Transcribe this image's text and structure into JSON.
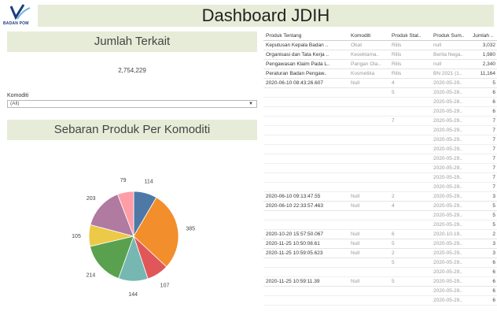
{
  "logo": {
    "text": "BADAN POM"
  },
  "header": {
    "title": "Dashboard JDIH"
  },
  "jumlah_terkait": {
    "title": "Jumlah Terkait",
    "value": "2,754,229"
  },
  "filter": {
    "label": "Komoditi",
    "selected": "(All)"
  },
  "sebaran": {
    "title": "Sebaran Produk Per Komoditi"
  },
  "table": {
    "columns": [
      "Produk Tentang",
      "Komoditi",
      "Produk Stat..",
      "Produk Sum..",
      "Jumlah .."
    ],
    "rows": [
      [
        "Keputusan Kepala Badan ..",
        "Obat",
        "Rilis",
        "null",
        "3,032"
      ],
      [
        "Organisasi dan Tata Kerja ..",
        "Kesektama..",
        "Rilis",
        "Berita Nega..",
        "1,980"
      ],
      [
        "Pengawasan Klaim Pada L..",
        "Pangan Ola..",
        "Rilis",
        "null",
        "2,340"
      ],
      [
        "Peraturan Badan Pengaw..",
        "Kosmetika",
        "Rilis",
        "BN 2021 (1..",
        "11,164"
      ],
      [
        "2020-06-10 08:43:26.607",
        "Null",
        "4",
        "2020-05-29..",
        "5"
      ],
      [
        "",
        "",
        "5",
        "2020-05-28..",
        "6"
      ],
      [
        "",
        "",
        "",
        "2020-05-28..",
        "6"
      ],
      [
        "",
        "",
        "",
        "2020-05-29..",
        "6"
      ],
      [
        "",
        "",
        "7",
        "2020-05-29..",
        "7"
      ],
      [
        "",
        "",
        "",
        "2020-05-29..",
        "7"
      ],
      [
        "",
        "",
        "",
        "2020-05-29..",
        "7"
      ],
      [
        "",
        "",
        "",
        "2020-05-29..",
        "7"
      ],
      [
        "",
        "",
        "",
        "2020-05-29..",
        "7"
      ],
      [
        "",
        "",
        "",
        "2020-05-29..",
        "7"
      ],
      [
        "",
        "",
        "",
        "2020-05-29..",
        "7"
      ],
      [
        "",
        "",
        "",
        "2020-05-29..",
        "7"
      ],
      [
        "2020-06-10 09:13:47.55",
        "Null",
        "2",
        "2020-05-29..",
        "3"
      ],
      [
        "2020-06-10 22:33:57.463",
        "Null",
        "4",
        "2020-05-29..",
        "5"
      ],
      [
        "",
        "",
        "",
        "2020-05-29..",
        "5"
      ],
      [
        "",
        "",
        "",
        "2020-05-29..",
        "5"
      ],
      [
        "2020-10-20 15:57:50.067",
        "Null",
        "6",
        "2020-10-19..",
        "2"
      ],
      [
        "2020-11-25 10:50:08.61",
        "Null",
        "5",
        "2020-05-29..",
        "3"
      ],
      [
        "2020-11-25 10:59:05.623",
        "Null",
        "2",
        "2020-05-29..",
        "3"
      ],
      [
        "",
        "",
        "5",
        "2020-05-29..",
        "6"
      ],
      [
        "",
        "",
        "",
        "2020-05-29..",
        "6"
      ],
      [
        "2020-11-25 10:59:11.39",
        "Null",
        "5",
        "2020-05-29..",
        "6"
      ],
      [
        "",
        "",
        "",
        "2020-05-29..",
        "6"
      ],
      [
        "",
        "",
        "",
        "2020-05-29..",
        "6"
      ]
    ]
  },
  "chart_data": {
    "type": "pie",
    "values": [
      114,
      385,
      107,
      144,
      214,
      105,
      203,
      79
    ],
    "colors": [
      "#4e79a7",
      "#f28e2b",
      "#e15759",
      "#76b7b2",
      "#59a14f",
      "#edc948",
      "#b07aa1",
      "#ff9da7"
    ]
  }
}
